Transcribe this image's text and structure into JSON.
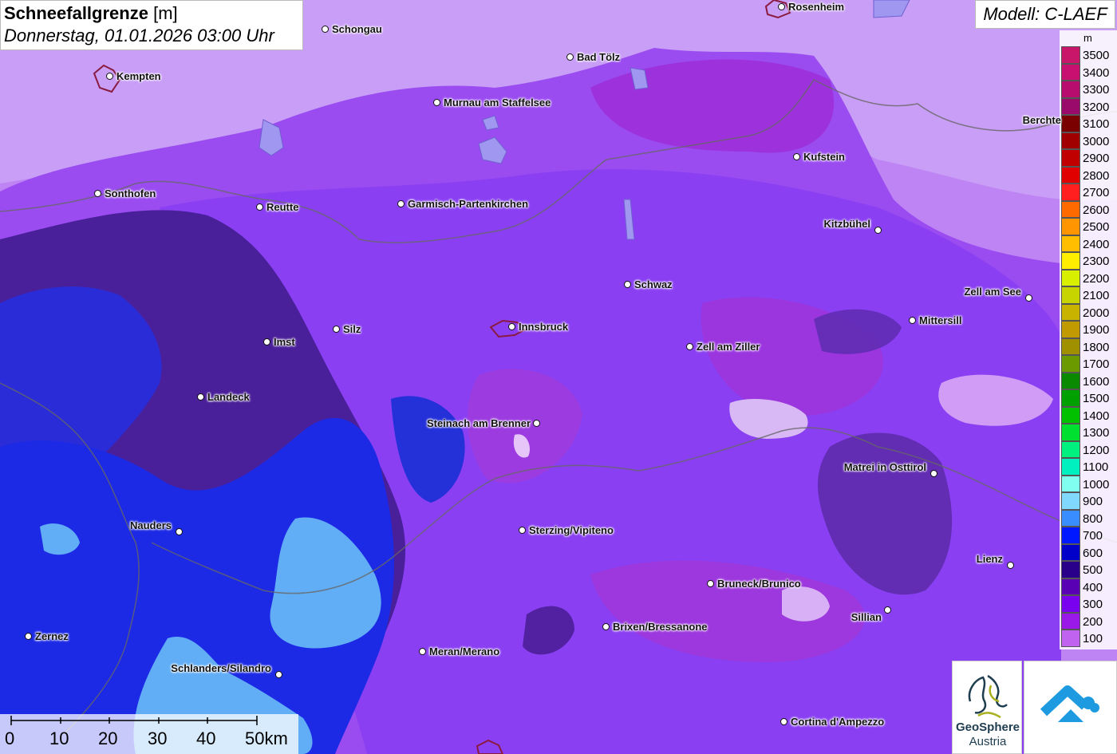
{
  "title": {
    "bold": "Schneefallgrenze",
    "unit": "[m]",
    "datetime": "Donnerstag, 01.01.2026 03:00 Uhr"
  },
  "model": "Modell: C-LAEF",
  "legend": {
    "unit": "m",
    "entries": [
      {
        "label": "3500",
        "color": "#c8166a"
      },
      {
        "label": "3400",
        "color": "#c81070"
      },
      {
        "label": "3300",
        "color": "#b70d6e"
      },
      {
        "label": "3200",
        "color": "#9a0a6a"
      },
      {
        "label": "3100",
        "color": "#7a0000"
      },
      {
        "label": "3000",
        "color": "#a00000"
      },
      {
        "label": "2900",
        "color": "#c00000"
      },
      {
        "label": "2800",
        "color": "#e00000"
      },
      {
        "label": "2700",
        "color": "#ff1f1f"
      },
      {
        "label": "2600",
        "color": "#ff6a00"
      },
      {
        "label": "2500",
        "color": "#ff9500"
      },
      {
        "label": "2400",
        "color": "#ffbe00"
      },
      {
        "label": "2300",
        "color": "#ffee00"
      },
      {
        "label": "2200",
        "color": "#d9ef00"
      },
      {
        "label": "2100",
        "color": "#c8d400"
      },
      {
        "label": "2000",
        "color": "#c8b400"
      },
      {
        "label": "1900",
        "color": "#c09a00"
      },
      {
        "label": "1800",
        "color": "#a09000"
      },
      {
        "label": "1700",
        "color": "#6a9a00"
      },
      {
        "label": "1600",
        "color": "#0a8a00"
      },
      {
        "label": "1500",
        "color": "#00a000"
      },
      {
        "label": "1400",
        "color": "#00c000"
      },
      {
        "label": "1300",
        "color": "#00e030"
      },
      {
        "label": "1200",
        "color": "#00f080"
      },
      {
        "label": "1100",
        "color": "#00f0c0"
      },
      {
        "label": "1000",
        "color": "#80fff0"
      },
      {
        "label": "900",
        "color": "#80d8ff"
      },
      {
        "label": "800",
        "color": "#3a8dff"
      },
      {
        "label": "700",
        "color": "#0018ff"
      },
      {
        "label": "600",
        "color": "#0000c8"
      },
      {
        "label": "500",
        "color": "#28008a"
      },
      {
        "label": "400",
        "color": "#5a00b4"
      },
      {
        "label": "300",
        "color": "#7a00f0"
      },
      {
        "label": "200",
        "color": "#9a18e8"
      },
      {
        "label": "100",
        "color": "#c064f0"
      }
    ]
  },
  "cities": [
    {
      "name": "Schongau"
    },
    {
      "name": "Rosenheim"
    },
    {
      "name": "Kempten"
    },
    {
      "name": "Bad Tölz"
    },
    {
      "name": "Murnau am Staffelsee"
    },
    {
      "name": "Berchte"
    },
    {
      "name": "Kufstein"
    },
    {
      "name": "Sonthofen"
    },
    {
      "name": "Reutte"
    },
    {
      "name": "Garmisch-Partenkirchen"
    },
    {
      "name": "Kitzbühel"
    },
    {
      "name": "Schwaz"
    },
    {
      "name": "Zell am See"
    },
    {
      "name": "Mittersill"
    },
    {
      "name": "Imst"
    },
    {
      "name": "Silz"
    },
    {
      "name": "Innsbruck"
    },
    {
      "name": "Zell am Ziller"
    },
    {
      "name": "Landeck"
    },
    {
      "name": "Steinach am Brenner"
    },
    {
      "name": "Matrei in Osttirol"
    },
    {
      "name": "Nauders"
    },
    {
      "name": "Sterzing/Vipiteno"
    },
    {
      "name": "Lienz"
    },
    {
      "name": "Bruneck/Brunico"
    },
    {
      "name": "Sillian"
    },
    {
      "name": "Brixen/Bressanone"
    },
    {
      "name": "Zernez"
    },
    {
      "name": "Meran/Merano"
    },
    {
      "name": "Schlanders/Silandro"
    },
    {
      "name": "Cortina d'Ampezzo"
    }
  ],
  "scale_bar": {
    "labels": [
      "0",
      "10",
      "20",
      "30",
      "40",
      "50km"
    ]
  },
  "logos": {
    "geosphere_line1": "GeoSphere",
    "geosphere_line2": "Austria"
  }
}
